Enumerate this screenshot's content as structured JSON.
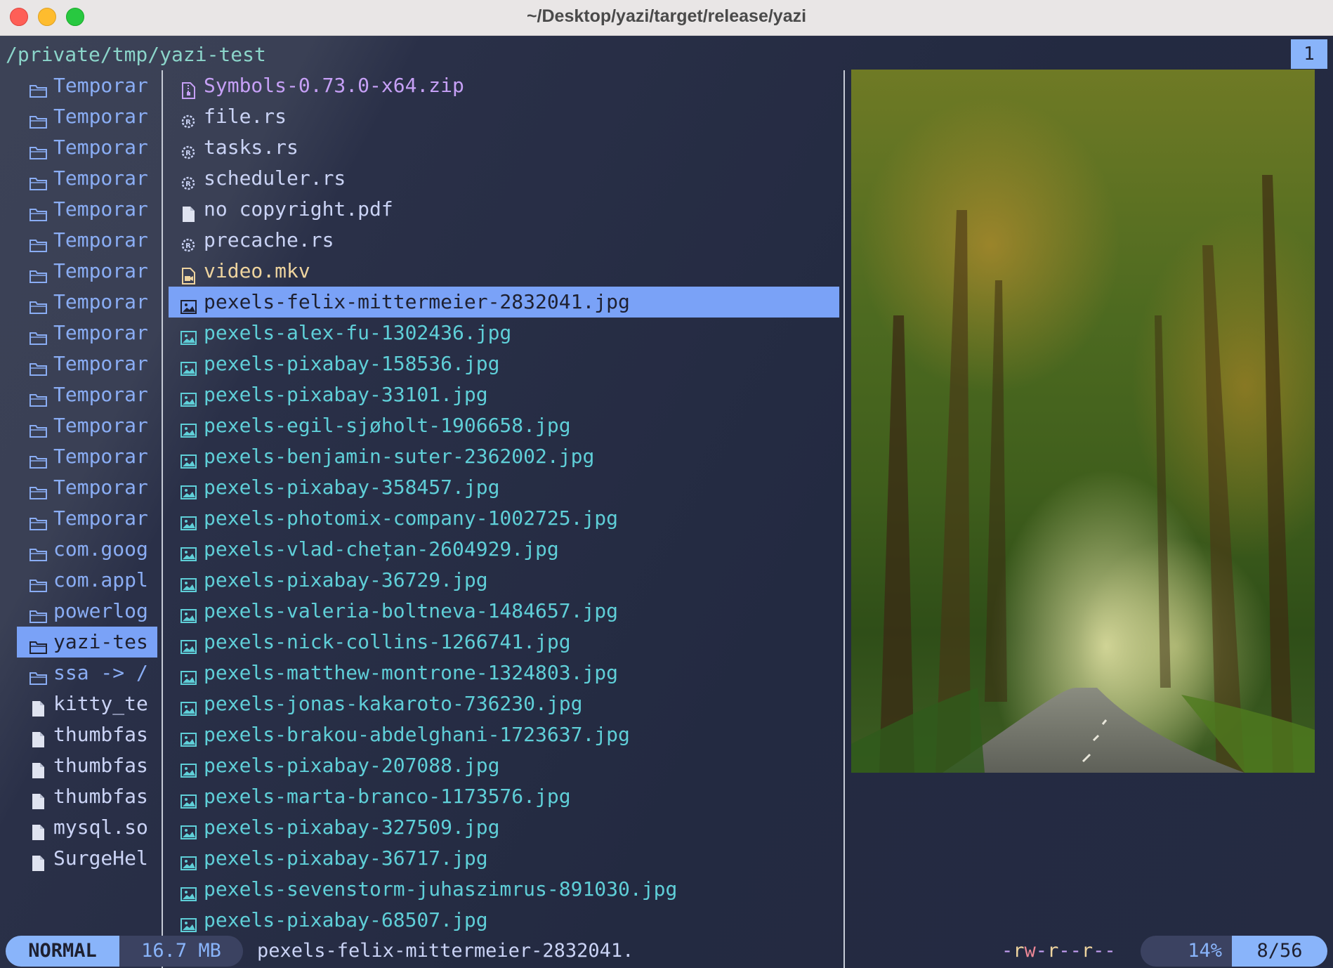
{
  "window": {
    "title": "~/Desktop/yazi/target/release/yazi"
  },
  "header": {
    "cwd": "/private/tmp/yazi-test",
    "tab_number": "1"
  },
  "parent": {
    "items": [
      {
        "name": "Temporar",
        "type": "dir"
      },
      {
        "name": "Temporar",
        "type": "dir"
      },
      {
        "name": "Temporar",
        "type": "dir"
      },
      {
        "name": "Temporar",
        "type": "dir"
      },
      {
        "name": "Temporar",
        "type": "dir"
      },
      {
        "name": "Temporar",
        "type": "dir"
      },
      {
        "name": "Temporar",
        "type": "dir"
      },
      {
        "name": "Temporar",
        "type": "dir"
      },
      {
        "name": "Temporar",
        "type": "dir"
      },
      {
        "name": "Temporar",
        "type": "dir"
      },
      {
        "name": "Temporar",
        "type": "dir"
      },
      {
        "name": "Temporar",
        "type": "dir"
      },
      {
        "name": "Temporar",
        "type": "dir"
      },
      {
        "name": "Temporar",
        "type": "dir"
      },
      {
        "name": "Temporar",
        "type": "dir"
      },
      {
        "name": "com.goog",
        "type": "dir"
      },
      {
        "name": "com.appl",
        "type": "dir"
      },
      {
        "name": "powerlog",
        "type": "dir"
      },
      {
        "name": "yazi-tes",
        "type": "dir",
        "selected": true
      },
      {
        "name": "ssa -> /",
        "type": "dir"
      },
      {
        "name": "kitty_te",
        "type": "file"
      },
      {
        "name": "thumbfas",
        "type": "file"
      },
      {
        "name": "thumbfas",
        "type": "file"
      },
      {
        "name": "thumbfas",
        "type": "file"
      },
      {
        "name": "mysql.so",
        "type": "file"
      },
      {
        "name": "SurgeHel",
        "type": "file"
      }
    ]
  },
  "current": {
    "items": [
      {
        "name": "Symbols-0.73.0-x64.zip",
        "type": "zip"
      },
      {
        "name": "file.rs",
        "type": "rust"
      },
      {
        "name": "tasks.rs",
        "type": "rust"
      },
      {
        "name": "scheduler.rs",
        "type": "rust"
      },
      {
        "name": "no copyright.pdf",
        "type": "plain"
      },
      {
        "name": "precache.rs",
        "type": "rust"
      },
      {
        "name": "video.mkv",
        "type": "video"
      },
      {
        "name": "pexels-felix-mittermeier-2832041.jpg",
        "type": "image",
        "selected": true
      },
      {
        "name": "pexels-alex-fu-1302436.jpg",
        "type": "image"
      },
      {
        "name": "pexels-pixabay-158536.jpg",
        "type": "image"
      },
      {
        "name": "pexels-pixabay-33101.jpg",
        "type": "image"
      },
      {
        "name": "pexels-egil-sjøholt-1906658.jpg",
        "type": "image"
      },
      {
        "name": "pexels-benjamin-suter-2362002.jpg",
        "type": "image"
      },
      {
        "name": "pexels-pixabay-358457.jpg",
        "type": "image"
      },
      {
        "name": "pexels-photomix-company-1002725.jpg",
        "type": "image"
      },
      {
        "name": "pexels-vlad-chețan-2604929.jpg",
        "type": "image"
      },
      {
        "name": "pexels-pixabay-36729.jpg",
        "type": "image"
      },
      {
        "name": "pexels-valeria-boltneva-1484657.jpg",
        "type": "image"
      },
      {
        "name": "pexels-nick-collins-1266741.jpg",
        "type": "image"
      },
      {
        "name": "pexels-matthew-montrone-1324803.jpg",
        "type": "image"
      },
      {
        "name": "pexels-jonas-kakaroto-736230.jpg",
        "type": "image"
      },
      {
        "name": "pexels-brakou-abdelghani-1723637.jpg",
        "type": "image"
      },
      {
        "name": "pexels-pixabay-207088.jpg",
        "type": "image"
      },
      {
        "name": "pexels-marta-branco-1173576.jpg",
        "type": "image"
      },
      {
        "name": "pexels-pixabay-327509.jpg",
        "type": "image"
      },
      {
        "name": "pexels-pixabay-36717.jpg",
        "type": "image"
      },
      {
        "name": "pexels-sevenstorm-juhaszimrus-891030.jpg",
        "type": "image"
      },
      {
        "name": "pexels-pixabay-68507.jpg",
        "type": "image"
      }
    ]
  },
  "status": {
    "mode": "NORMAL",
    "size": "16.7 MB",
    "filename": "pexels-felix-mittermeier-2832041.",
    "permissions": "-rw-r--r--",
    "percent": "14%",
    "position": "8/56"
  },
  "colors": {
    "accent": "#89b4fa",
    "dir": "#8aadf4",
    "image": "#5fcfd8",
    "zip": "#c6a0f6",
    "video": "#eed49f"
  }
}
